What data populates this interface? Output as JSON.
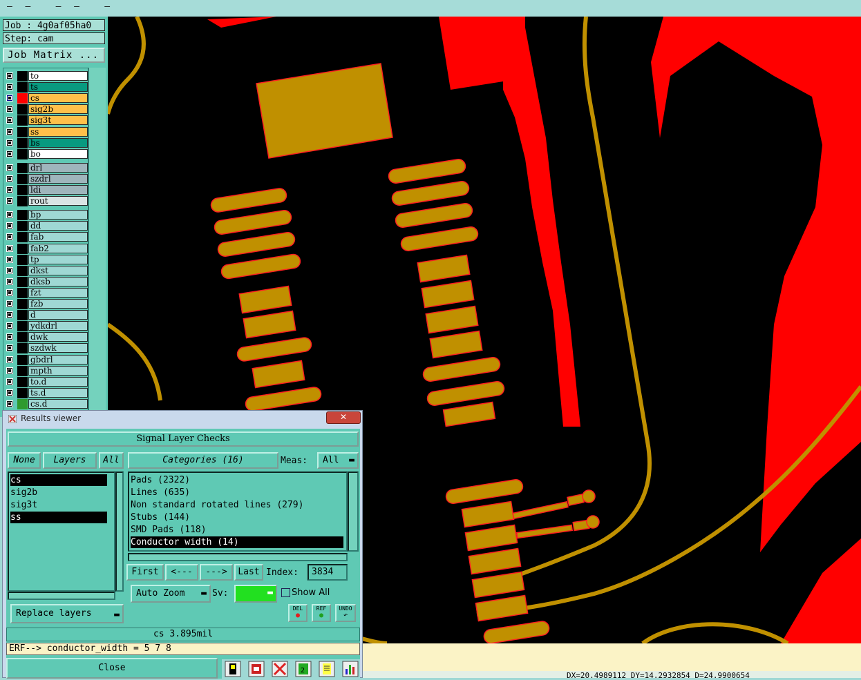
{
  "left_panel": {
    "job_label": "Job : 4g0af05ha0",
    "step_label": "Step: cam",
    "job_matrix_button": "Job Matrix ...",
    "layers": [
      {
        "name": "to",
        "color": "#ffffff",
        "swatch": "#000000",
        "mark": "✐"
      },
      {
        "name": "ts",
        "color": "#089a80",
        "swatch": "#000000",
        "mark": ""
      },
      {
        "name": "cs",
        "color": "#ffc04a",
        "swatch": "#ff0000",
        "mark": "✐▣",
        "checked": true
      },
      {
        "name": "sig2b",
        "color": "#ffc04a",
        "swatch": "#000000",
        "mark": ""
      },
      {
        "name": "sig3t",
        "color": "#ffc04a",
        "swatch": "#000000",
        "mark": ""
      },
      {
        "name": "ss",
        "color": "#ffc04a",
        "swatch": "#000000",
        "mark": "✐"
      },
      {
        "name": "bs",
        "color": "#089a80",
        "swatch": "#000000",
        "mark": ""
      },
      {
        "name": "bo",
        "color": "#ffffff",
        "swatch": "#000000",
        "mark": ""
      },
      {
        "name": "drl",
        "color": "#9fb5bc",
        "swatch": "#000000",
        "mark": ""
      },
      {
        "name": "szdrl",
        "color": "#9fb5bc",
        "swatch": "#000000",
        "mark": ""
      },
      {
        "name": "ldi",
        "color": "#9fb5bc",
        "swatch": "#000000",
        "mark": ""
      },
      {
        "name": "rout",
        "color": "#d9e4e4",
        "swatch": "#000000",
        "mark": ""
      },
      {
        "name": "bp",
        "color": "#9fd8d4",
        "swatch": "#000000",
        "mark": ""
      },
      {
        "name": "dd",
        "color": "#9fd8d4",
        "swatch": "#000000",
        "mark": ""
      },
      {
        "name": "fab",
        "color": "#9fd8d4",
        "swatch": "#000000",
        "mark": "✐"
      },
      {
        "name": "fab2",
        "color": "#9fd8d4",
        "swatch": "#000000",
        "mark": "✐"
      },
      {
        "name": "tp",
        "color": "#9fd8d4",
        "swatch": "#000000",
        "mark": ""
      },
      {
        "name": "dkst",
        "color": "#9fd8d4",
        "swatch": "#000000",
        "mark": ""
      },
      {
        "name": "dksb",
        "color": "#9fd8d4",
        "swatch": "#000000",
        "mark": ""
      },
      {
        "name": "fzt",
        "color": "#9fd8d4",
        "swatch": "#000000",
        "mark": ""
      },
      {
        "name": "fzb",
        "color": "#9fd8d4",
        "swatch": "#000000",
        "mark": ""
      },
      {
        "name": "d",
        "color": "#9fd8d4",
        "swatch": "#000000",
        "mark": ""
      },
      {
        "name": "ydkdrl",
        "color": "#9fd8d4",
        "swatch": "#000000",
        "mark": ""
      },
      {
        "name": "dwk",
        "color": "#9fd8d4",
        "swatch": "#000000",
        "mark": ""
      },
      {
        "name": "szdwk",
        "color": "#9fd8d4",
        "swatch": "#000000",
        "mark": ""
      },
      {
        "name": "gbdrl",
        "color": "#9fd8d4",
        "swatch": "#000000",
        "mark": ""
      },
      {
        "name": "mpth",
        "color": "#9fd8d4",
        "swatch": "#000000",
        "mark": ""
      },
      {
        "name": "to.d",
        "color": "#9fd8d4",
        "swatch": "#000000",
        "mark": "✐"
      },
      {
        "name": "ts.d",
        "color": "#9fd8d4",
        "swatch": "#000000",
        "mark": ""
      },
      {
        "name": "cs.d",
        "color": "#9fd8d4",
        "swatch": "#2f9a2f",
        "mark": "✐"
      }
    ]
  },
  "results_viewer": {
    "window_title": "Results viewer",
    "close_x": "✕",
    "section_title": "Signal Layer Checks",
    "none_button": "None",
    "layers_button": "Layers",
    "all_button": "All",
    "categories_button": "Categories (16)",
    "meas_label": "Meas:",
    "meas_value": "All",
    "layer_items": [
      {
        "name": "cs",
        "selected": true
      },
      {
        "name": "sig2b",
        "selected": false
      },
      {
        "name": "sig3t",
        "selected": false
      },
      {
        "name": "ss",
        "selected": true
      }
    ],
    "category_items": [
      {
        "name": "Pads (2322)",
        "selected": false
      },
      {
        "name": "Lines (635)",
        "selected": false
      },
      {
        "name": "Non standard rotated lines (279)",
        "selected": false
      },
      {
        "name": "Stubs (144)",
        "selected": false
      },
      {
        "name": "SMD Pads (118)",
        "selected": false
      },
      {
        "name": "Conductor width (14)",
        "selected": true
      }
    ],
    "first_button": "First",
    "prev_button": "<---",
    "next_button": "--->",
    "last_button": "Last",
    "index_label": "Index:",
    "index_value": "3834",
    "auto_zoom_button": "Auto Zoom",
    "sv_label": "Sv:",
    "show_all_label": "Show All",
    "replace_layers_button": "Replace layers",
    "del_button": "DEL",
    "ref_button": "REF",
    "undo_button": "UNDO",
    "status_value": "cs 3.895mil",
    "erf_text": "ERF--> conductor_width = 5 7 8",
    "close_button": "Close"
  },
  "status": {
    "coordinates": "DX=20.4989112 DY=14.2932854 D=24.9900654"
  },
  "colors": {
    "panel_teal": "#5fc9b4",
    "copper": "#c09000",
    "outline_red": "#ff0000",
    "canvas_black": "#000000"
  }
}
